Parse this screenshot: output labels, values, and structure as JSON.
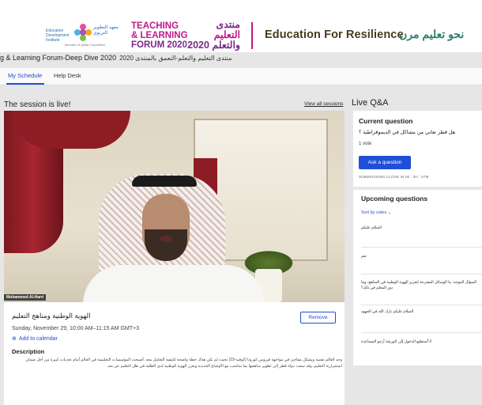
{
  "header": {
    "edi_name_en": "Education Development Institute",
    "edi_name_ar": "معهد التطوير التربوي",
    "edi_tagline": "Member of Qatar Foundation",
    "forum_en_line1": "TEACHING",
    "forum_en_line2": "& LEARNING",
    "forum_en_line3": "FORUM 2020",
    "forum_ar_line1": "منتدى",
    "forum_ar_line2": "التعليم",
    "forum_ar_line3": "والتعلم 2020",
    "efr_en": "Education For Resilience",
    "efr_ar": "نحو تعليم مرن"
  },
  "forum_title": "g & Learning Forum-Deep Dive 2020",
  "forum_title_ar": "منتدى التعليم والتعلم-التعمق بالمنتدى 2020",
  "nav": {
    "items": [
      "My Schedule",
      "Help Desk"
    ]
  },
  "session": {
    "live_label": "The session is live!",
    "view_all": "View all sessions",
    "speaker_name": "Mohammed Al-Harri",
    "title": "الهوية الوطنية ومناهج التعليم",
    "date": "Sunday, November 29, 10:00 AM–11:15 AM GMT+3",
    "add_calendar": "Add to calendar",
    "remove": "Remove",
    "description_heading": "Description",
    "description": "وجد العالم نفسه وبشكل مفاجئ في مواجهة فيروس كورونا (كوفيد-19) بحيث لم تكن هناك خطة واضحة لكيفية التعامل معه. أصبحت المؤسسات التعليمية في العالم أمام تحديات كبيرة من أجل ضمان استمرارية التعليم، وقد سعت دولة قطر إلى تطوير مناهجها بما يتناسب مع الأوضاع الجديدة ويعزز الهوية الوطنية لدى الطلبة في ظل التعليم عن بعد."
  },
  "qa": {
    "title": "Live Q&A",
    "current_heading": "Current question",
    "current_question": "هل قطر تعاني من مشاكل في الديموقراطية ؟",
    "votes": "1 vote",
    "ask_button": "Ask a question",
    "submissions": "SUBMISSIONS CLOSE IN 00 : 0H : 57M",
    "upcoming_heading": "Upcoming questions",
    "sort": "Sort by votes",
    "items": [
      "السلام عليكم",
      "نعم",
      "السؤال الموجه: ما الوسائل المقترحة لتعزيز الهوية الوطنية في المناهج، وما دور المعلم في ذلك؟",
      "السلام عليكم بارك الله في الجهود",
      "لا أستطيع الدخول إلى الورشة أرجو المساعدة"
    ]
  },
  "colors": {
    "accent": "#1f4fd6",
    "forum_magenta": "#c0198a",
    "forum_purple": "#7a2a8a",
    "efr_green": "#2e7f6e"
  }
}
